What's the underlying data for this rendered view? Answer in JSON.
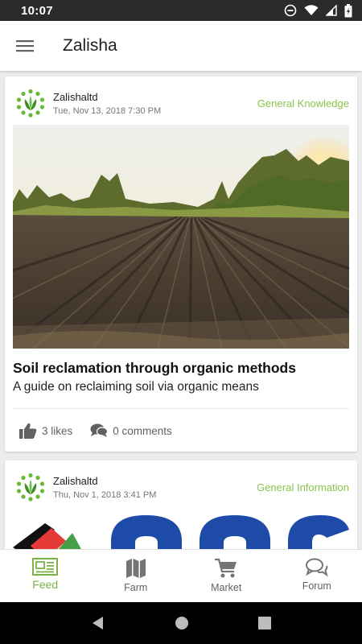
{
  "status_bar": {
    "time": "10:07"
  },
  "app_bar": {
    "title": "Zalisha"
  },
  "posts": [
    {
      "author": "Zalishaltd",
      "date": "Tue, Nov 13, 2018 7:30 PM",
      "category": "General Knowledge",
      "title": "Soil reclamation through organic methods",
      "description": "A guide on reclaiming soil via organic means",
      "likes": "3 likes",
      "comments": "0 comments"
    },
    {
      "author": "Zalishaltd",
      "date": "Thu, Nov 1, 2018 3:41 PM",
      "category": "General Information"
    }
  ],
  "bottom_nav": [
    {
      "label": "Feed",
      "icon": "newspaper-icon",
      "active": true
    },
    {
      "label": "Farm",
      "icon": "map-icon",
      "active": false
    },
    {
      "label": "Market",
      "icon": "cart-icon",
      "active": false
    },
    {
      "label": "Forum",
      "icon": "chat-bubbles-icon",
      "active": false
    }
  ],
  "colors": {
    "accent": "#8bc34a",
    "status_bar": "#2b2b2b"
  }
}
